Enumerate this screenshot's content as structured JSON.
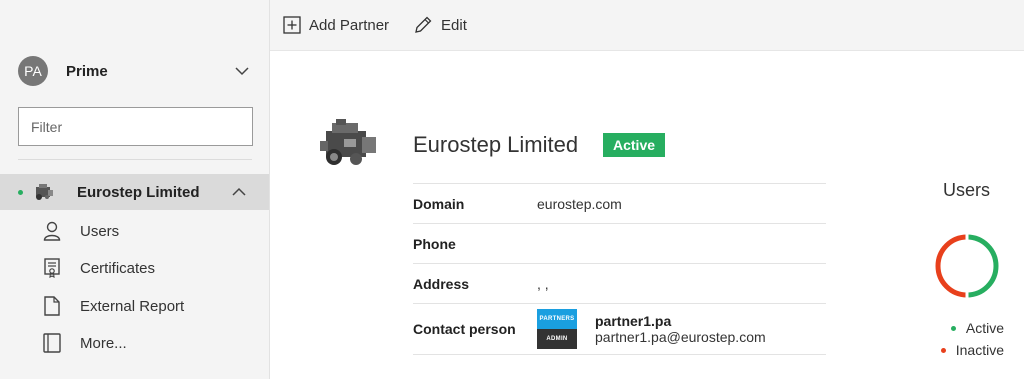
{
  "sidebar": {
    "account": {
      "initials": "PA",
      "name": "Prime"
    },
    "filter_placeholder": "Filter",
    "org": {
      "name": "Eurostep Limited",
      "status_color": "#27ae60"
    },
    "items": [
      {
        "label": "Users",
        "icon": "user-icon"
      },
      {
        "label": "Certificates",
        "icon": "certificate-icon"
      },
      {
        "label": "External Report",
        "icon": "document-icon"
      },
      {
        "label": "More...",
        "icon": "book-icon"
      }
    ]
  },
  "toolbar": {
    "add_partner_label": "Add Partner",
    "edit_label": "Edit"
  },
  "main": {
    "title": "Eurostep Limited",
    "status": "Active",
    "status_color": "#27ae60",
    "fields": {
      "domain_label": "Domain",
      "domain_value": "eurostep.com",
      "phone_label": "Phone",
      "phone_value": "",
      "address_label": "Address",
      "address_value": ", ,",
      "contact_label": "Contact person"
    },
    "contact": {
      "avatar_top": "PARTNERS",
      "avatar_bottom": "ADMIN",
      "name": "partner1.pa",
      "email": "partner1.pa@eurostep.com"
    }
  },
  "users_widget": {
    "title": "Users",
    "legend": [
      {
        "label": "Active",
        "color": "#27ae60"
      },
      {
        "label": "Inactive",
        "color": "#e8401c"
      }
    ]
  }
}
